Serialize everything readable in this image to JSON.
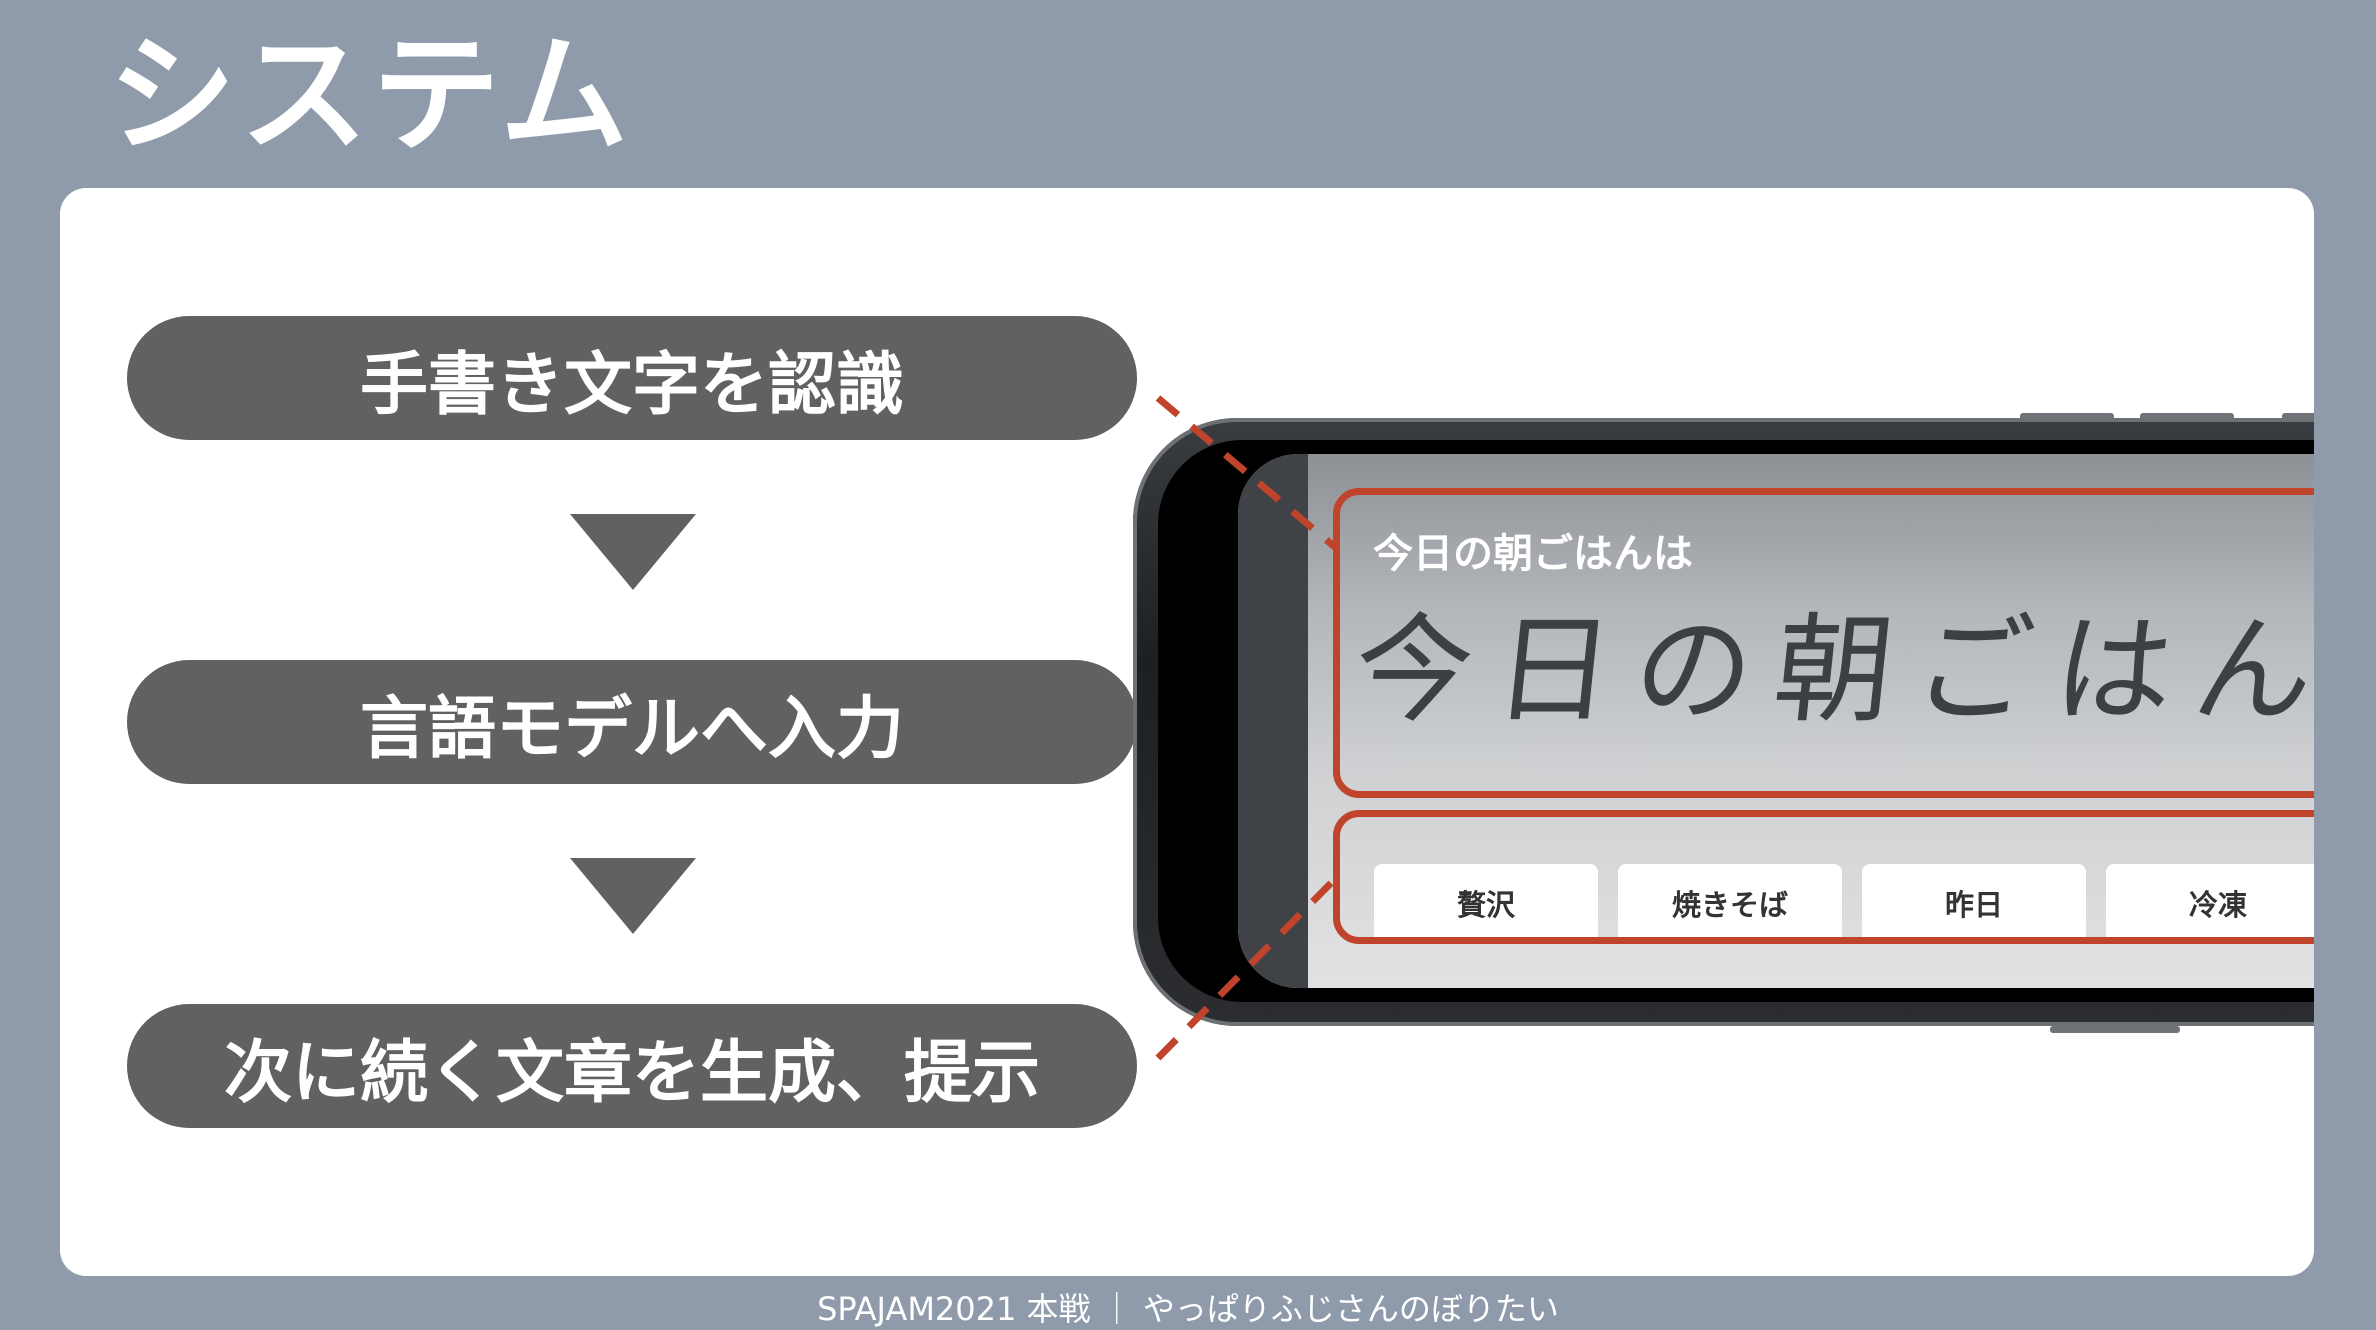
{
  "slide": {
    "title": "システム",
    "footer": "SPAJAM2021 本戦 ｜ やっぱりふじさんのぼりたい"
  },
  "steps": [
    {
      "label": "手書き文字を認識"
    },
    {
      "label": "言語モデルへ入力"
    },
    {
      "label": "次に続く文章を生成、提示"
    }
  ],
  "phone": {
    "prompt_label": "今日の朝ごはんは",
    "handwritten_text": "今日の朝ごはんは",
    "suggestions": [
      "贅沢",
      "焼きそば",
      "昨日",
      "冷凍"
    ]
  },
  "colors": {
    "background": "#8f9bab",
    "pill": "#616161",
    "accent_red": "#c0432b"
  }
}
